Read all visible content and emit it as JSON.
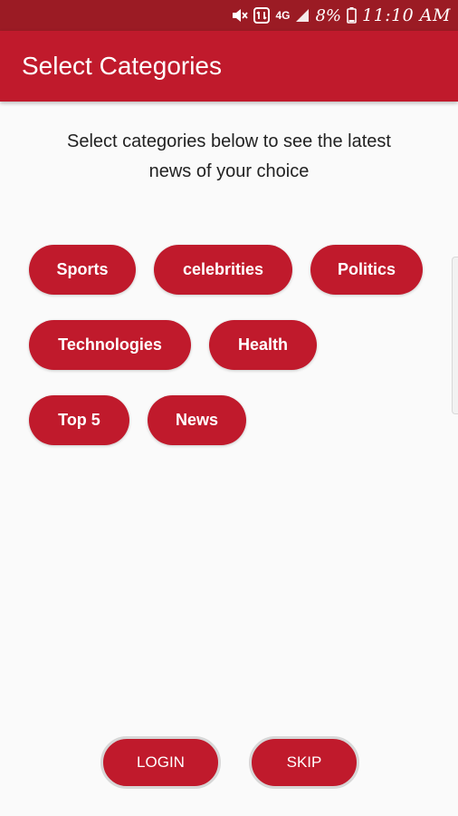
{
  "status_bar": {
    "time": "11:10 AM",
    "battery_percent": "8%",
    "network_label": "4G",
    "icons": [
      "mute-icon",
      "data-icon",
      "network-4g-icon",
      "signal-icon",
      "battery-icon"
    ]
  },
  "app_bar": {
    "title": "Select Categories"
  },
  "intro": {
    "line1": "Select categories below to see the latest",
    "line2": "news of your choice"
  },
  "categories": {
    "row1": [
      "Sports",
      "celebrities",
      "Politics"
    ],
    "row2": [
      "Technologies",
      "Health"
    ],
    "row3": [
      "Top 5",
      "News"
    ]
  },
  "actions": {
    "login_label": "LOGIN",
    "skip_label": "SKIP"
  },
  "colors": {
    "primary": "#c01a2c",
    "status_bar": "#9b1b24",
    "background": "#fafafa"
  }
}
